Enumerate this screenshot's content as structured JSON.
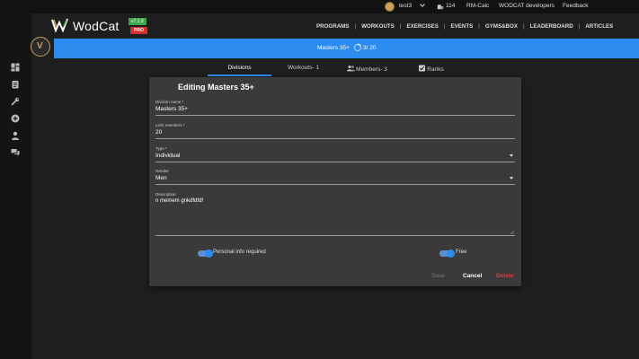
{
  "topbar": {
    "username": "test3",
    "count": "114",
    "rm_calc": "RM-Calc",
    "developers": "WODCAT developers",
    "feedback": "Feedback"
  },
  "brand": {
    "name": "WodCat",
    "version": "v7.1.9",
    "pro": "PRO"
  },
  "nav": [
    "PROGRAMS",
    "WORKOUTS",
    "EXERCISES",
    "EVENTS",
    "GYMS&BOX",
    "LEADERBOARD",
    "ARTICLES"
  ],
  "banner": {
    "division": "Masters 35+",
    "count": "3/ 20"
  },
  "tabs": [
    {
      "label": "Divisions"
    },
    {
      "label": "Workouts- 1"
    },
    {
      "label": "Members- 3"
    },
    {
      "label": "Ranks"
    }
  ],
  "dialog": {
    "title": "Editing Masters 35+",
    "division_name_label": "Division name *",
    "division_name_value": "Masters 35+",
    "limit_label": "Limit members *",
    "limit_value": "20",
    "type_label": "Type *",
    "type_value": "Individual",
    "gender_label": "Gender",
    "gender_value": "Men",
    "description_label": "Description",
    "description_value": "n memem gnkdfdfdf",
    "personal_info_label": "Personal info required",
    "free_label": "Free",
    "save": "Save",
    "cancel": "Cancel",
    "delete": "Delete"
  },
  "colors": {
    "accent": "#2d8cf0",
    "delete": "#e53935",
    "version_badge": "#3ea84a",
    "pro_badge": "#d32f2f"
  }
}
